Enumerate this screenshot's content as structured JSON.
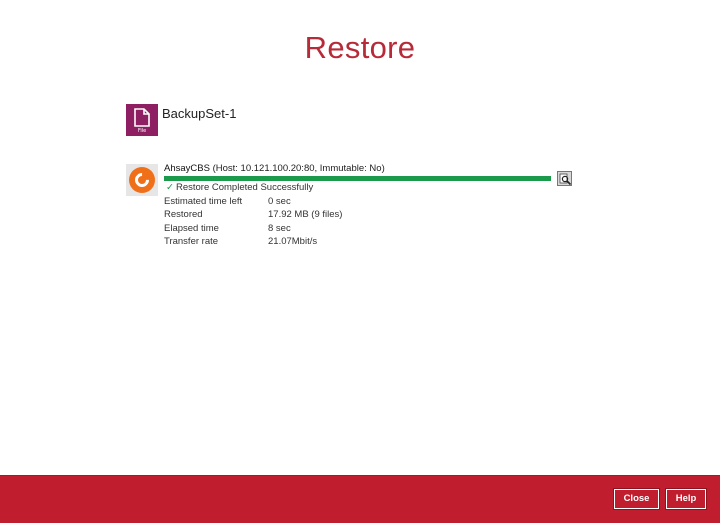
{
  "page": {
    "title": "Restore"
  },
  "backupset": {
    "name": "BackupSet-1",
    "icon": "file-icon",
    "icon_tag": "File"
  },
  "destination": {
    "icon": "ahsay-logo-icon",
    "name": "AhsayCBS",
    "details": "(Host: 10.121.100.20:80, Immutable: No)",
    "progress_percent": 100,
    "status": "Restore Completed Successfully",
    "stats": [
      {
        "label": "Estimated time left",
        "value": "0 sec"
      },
      {
        "label": "Restored",
        "value": "17.92 MB (9 files)"
      },
      {
        "label": "Elapsed time",
        "value": "8 sec"
      },
      {
        "label": "Transfer rate",
        "value": "21.07Mbit/s"
      }
    ],
    "log_icon": "magnifier-log-icon"
  },
  "footer": {
    "close_label": "Close",
    "help_label": "Help"
  },
  "colors": {
    "accent": "#b72a38",
    "footer_bg": "#c01e2e",
    "progress": "#1a9a4a",
    "backupset_icon": "#8e1f63",
    "logo": "#f0701a"
  }
}
